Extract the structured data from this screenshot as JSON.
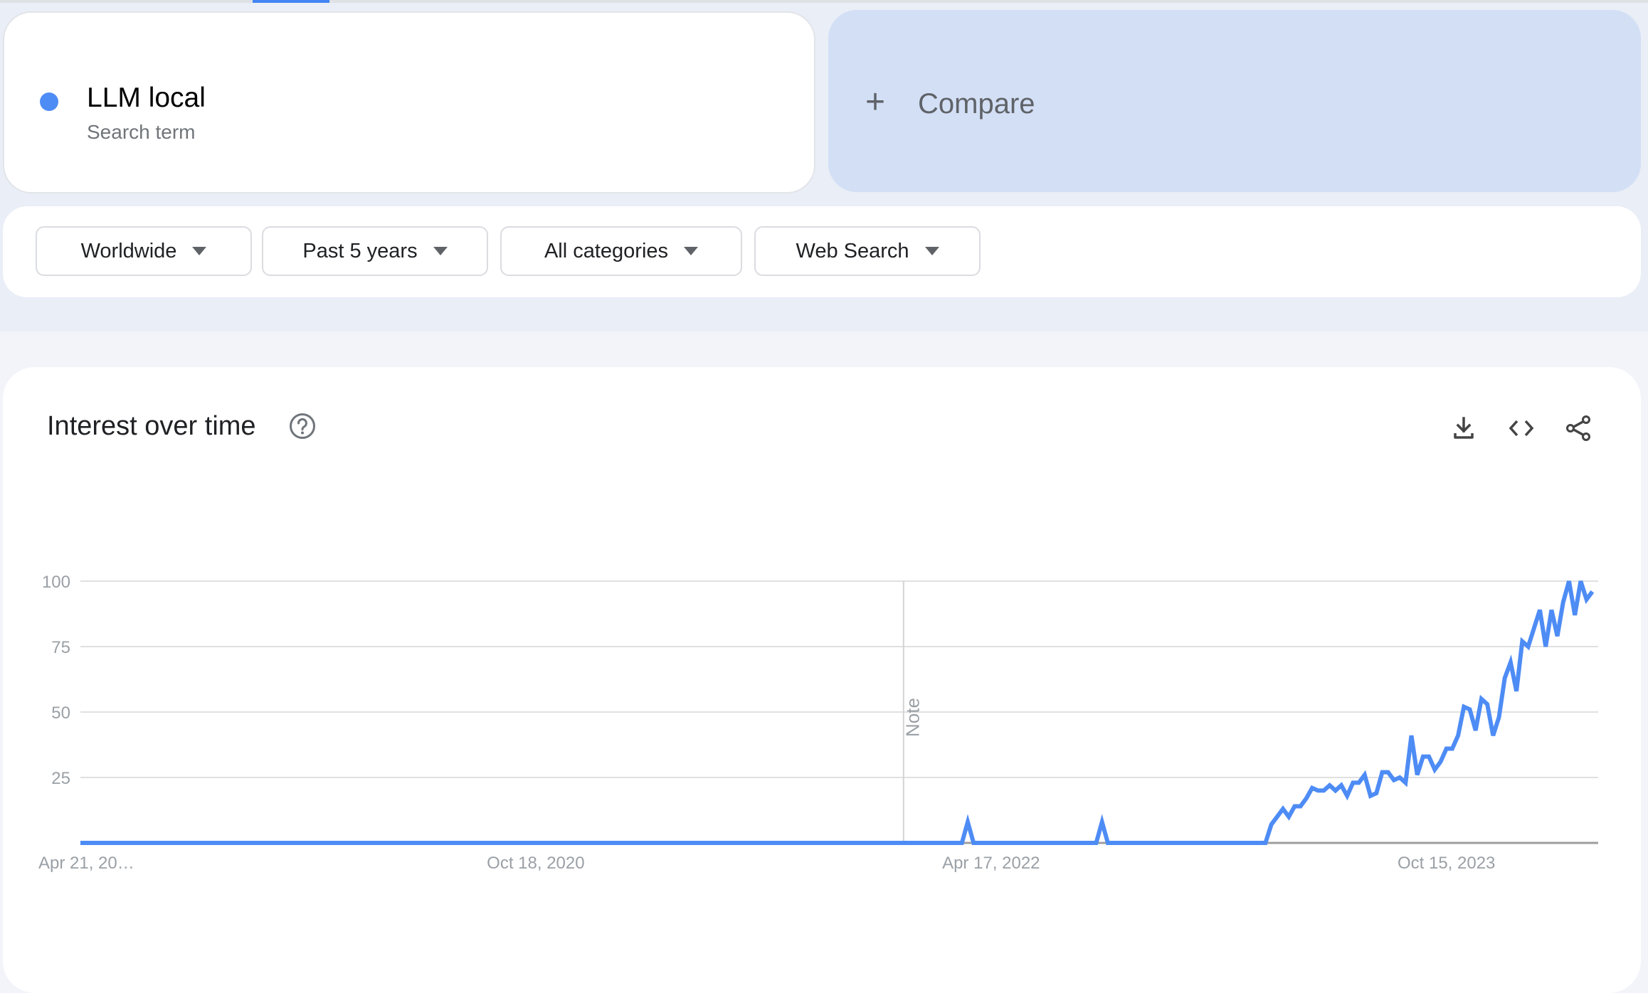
{
  "tabs": {
    "active_index": 0
  },
  "search_term": {
    "name": "LLM local",
    "subtitle": "Search term",
    "color": "#4e8cf5"
  },
  "compare": {
    "label": "Compare",
    "icon": "plus-icon"
  },
  "filters": [
    {
      "label": "Worldwide",
      "icon": "caret-down-icon"
    },
    {
      "label": "Past 5 years",
      "icon": "caret-down-icon"
    },
    {
      "label": "All categories",
      "icon": "caret-down-icon"
    },
    {
      "label": "Web Search",
      "icon": "caret-down-icon"
    }
  ],
  "panel": {
    "title": "Interest over time",
    "help_icon": "help-circle-icon",
    "actions": [
      {
        "name": "download",
        "icon": "download-icon"
      },
      {
        "name": "embed",
        "icon": "code-icon"
      },
      {
        "name": "share",
        "icon": "share-icon"
      }
    ]
  },
  "chart_data": {
    "type": "line",
    "title": "Interest over time",
    "xlabel": "",
    "ylabel": "",
    "ylim": [
      0,
      100
    ],
    "yticks": [
      25,
      50,
      75,
      100
    ],
    "grid": true,
    "legend": "none",
    "x_tick_labels": [
      {
        "label": "Apr 21, 20…",
        "week_index": 0
      },
      {
        "label": "Oct 18, 2020",
        "week_index": 78
      },
      {
        "label": "Apr 17, 2022",
        "week_index": 156
      },
      {
        "label": "Oct 15, 2023",
        "week_index": 234
      }
    ],
    "annotations": [
      {
        "label": "Note",
        "week_index": 141
      }
    ],
    "series": [
      {
        "name": "LLM local",
        "color": "#4e8cf5",
        "total_weeks": 261,
        "sparse_values": [
          [
            0,
            0
          ],
          [
            151,
            0
          ],
          [
            152,
            8
          ],
          [
            153,
            0
          ],
          [
            174,
            0
          ],
          [
            175,
            8
          ],
          [
            176,
            0
          ],
          [
            203,
            0
          ],
          [
            204,
            7
          ],
          [
            205,
            10
          ],
          [
            206,
            13
          ],
          [
            207,
            10
          ],
          [
            208,
            14
          ],
          [
            209,
            14
          ],
          [
            210,
            17
          ],
          [
            211,
            21
          ],
          [
            212,
            20
          ],
          [
            213,
            20
          ],
          [
            214,
            22
          ],
          [
            215,
            20
          ],
          [
            216,
            22
          ],
          [
            217,
            18
          ],
          [
            218,
            23
          ],
          [
            219,
            23
          ],
          [
            220,
            26
          ],
          [
            221,
            18
          ],
          [
            222,
            19
          ],
          [
            223,
            27
          ],
          [
            224,
            27
          ],
          [
            225,
            24
          ],
          [
            226,
            25
          ],
          [
            227,
            23
          ],
          [
            228,
            41
          ],
          [
            229,
            26
          ],
          [
            230,
            33
          ],
          [
            231,
            33
          ],
          [
            232,
            28
          ],
          [
            233,
            31
          ],
          [
            234,
            36
          ],
          [
            235,
            36
          ],
          [
            236,
            41
          ],
          [
            237,
            52
          ],
          [
            238,
            51
          ],
          [
            239,
            43
          ],
          [
            240,
            55
          ],
          [
            241,
            53
          ],
          [
            242,
            41
          ],
          [
            243,
            48
          ],
          [
            244,
            63
          ],
          [
            245,
            69
          ],
          [
            246,
            58
          ],
          [
            247,
            77
          ],
          [
            248,
            75
          ],
          [
            249,
            82
          ],
          [
            250,
            89
          ],
          [
            251,
            75
          ],
          [
            252,
            89
          ],
          [
            253,
            79
          ],
          [
            254,
            92
          ],
          [
            255,
            100
          ],
          [
            256,
            87
          ],
          [
            257,
            100
          ],
          [
            258,
            93
          ],
          [
            259,
            96
          ]
        ]
      }
    ]
  }
}
